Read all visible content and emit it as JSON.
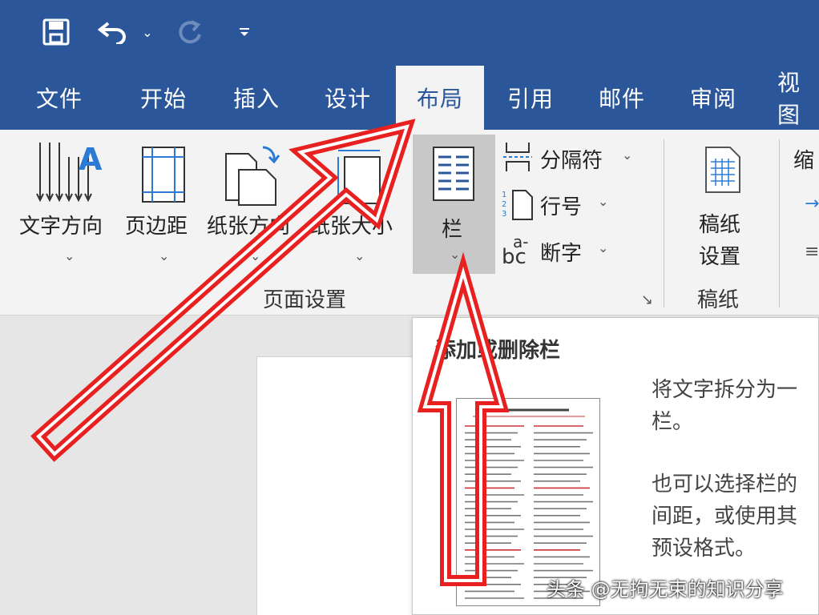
{
  "quick_access": {
    "save_icon": "save-icon",
    "undo_icon": "undo-icon",
    "redo_icon": "redo-icon",
    "customize_icon": "customize-quick-access-icon"
  },
  "tabs": [
    {
      "label": "文件"
    },
    {
      "label": "开始"
    },
    {
      "label": "插入"
    },
    {
      "label": "设计"
    },
    {
      "label": "布局",
      "active": true
    },
    {
      "label": "引用"
    },
    {
      "label": "邮件"
    },
    {
      "label": "审阅"
    },
    {
      "label": "视图"
    }
  ],
  "ribbon": {
    "text_direction": "文字方向",
    "margins": "页边距",
    "orientation": "纸张方向",
    "size": "纸张大小",
    "columns": "栏",
    "breaks": "分隔符",
    "line_numbers": "行号",
    "hyphenation": "断字",
    "hyphenation_icon_text": "a-",
    "hyphenation_icon_text2": "bc",
    "page_setup_group": "页面设置",
    "manuscript_settings_line1": "稿纸",
    "manuscript_settings_line2": "设置",
    "manuscript_group": "稿纸",
    "indent_label": "缩"
  },
  "tooltip": {
    "title": "添加或删除栏",
    "line1": "将文字拆分为一",
    "line2": "栏。",
    "line3": "也可以选择栏的",
    "line4": "间距，或使用其",
    "line5": "预设格式。"
  },
  "watermark": "头条 @无拘无束的知识分享",
  "colors": {
    "brand": "#2b579a",
    "arrow": "#e82020",
    "ribbon_bg": "#f3f3f3"
  }
}
